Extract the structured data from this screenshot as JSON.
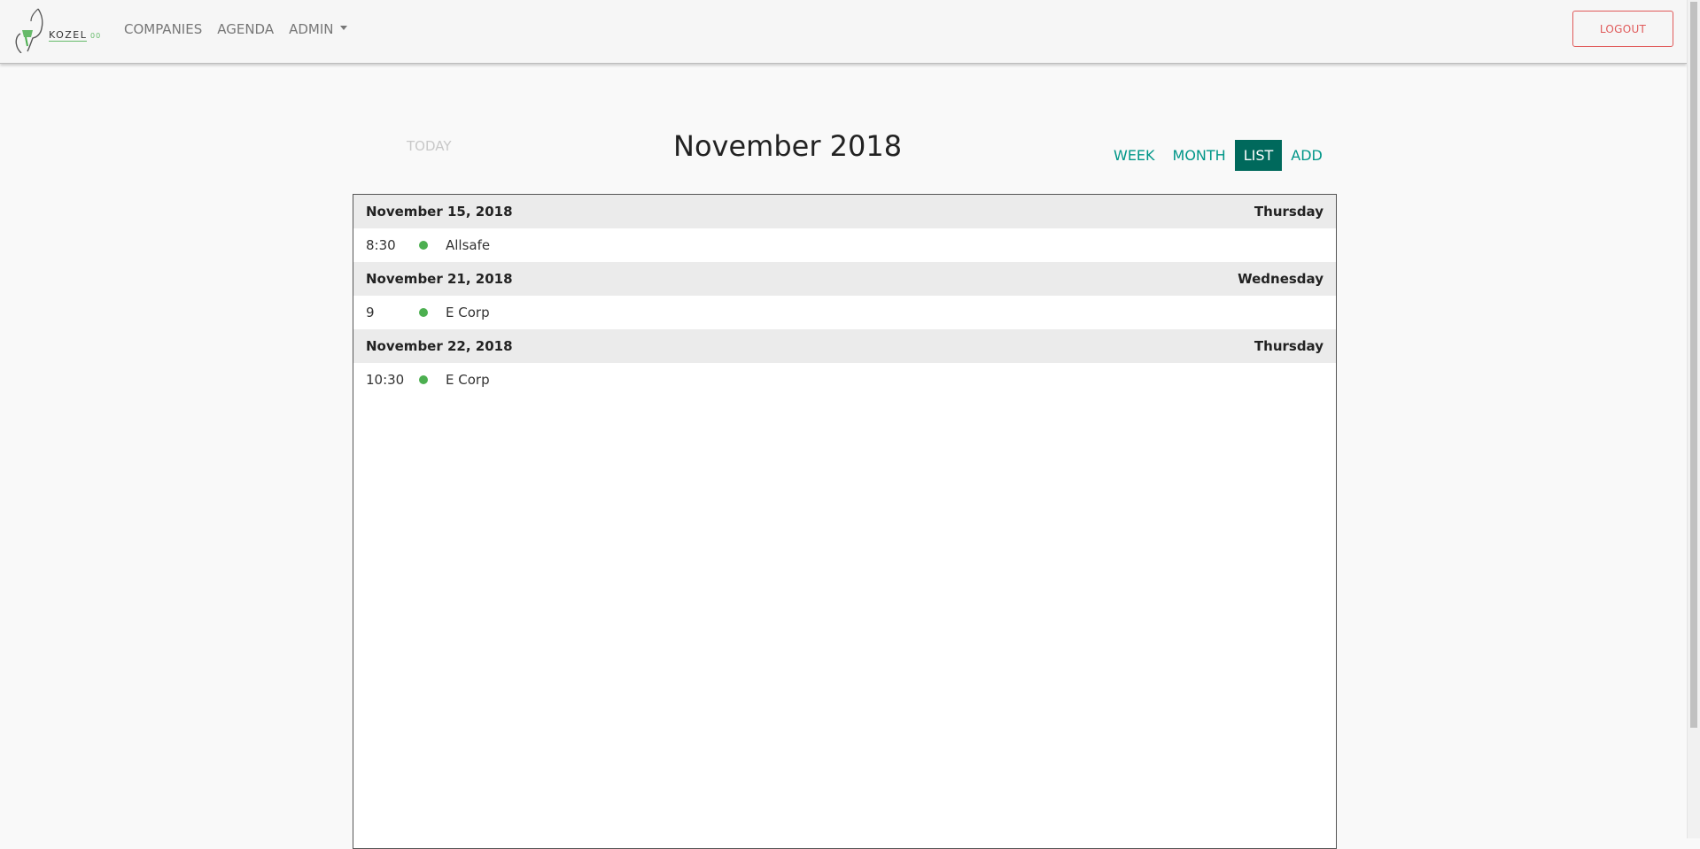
{
  "navbar": {
    "logo_text": "KOZEL",
    "logo_suffix": "00",
    "links": [
      "COMPANIES",
      "AGENDA",
      "ADMIN"
    ],
    "logout_label": "LOGOUT"
  },
  "calendar": {
    "today_label": "TODAY",
    "title": "November 2018",
    "views": [
      "WEEK",
      "MONTH",
      "LIST",
      "ADD"
    ],
    "active_view": "LIST",
    "accent_color": "#009688",
    "active_color": "#00695c",
    "event_dot_color": "#4caf50",
    "days": [
      {
        "date": "November 15, 2018",
        "weekday": "Thursday",
        "events": [
          {
            "time": "8:30",
            "title": "Allsafe"
          }
        ]
      },
      {
        "date": "November 21, 2018",
        "weekday": "Wednesday",
        "events": [
          {
            "time": "9",
            "title": "E Corp"
          }
        ]
      },
      {
        "date": "November 22, 2018",
        "weekday": "Thursday",
        "events": [
          {
            "time": "10:30",
            "title": "E Corp"
          }
        ]
      }
    ]
  }
}
